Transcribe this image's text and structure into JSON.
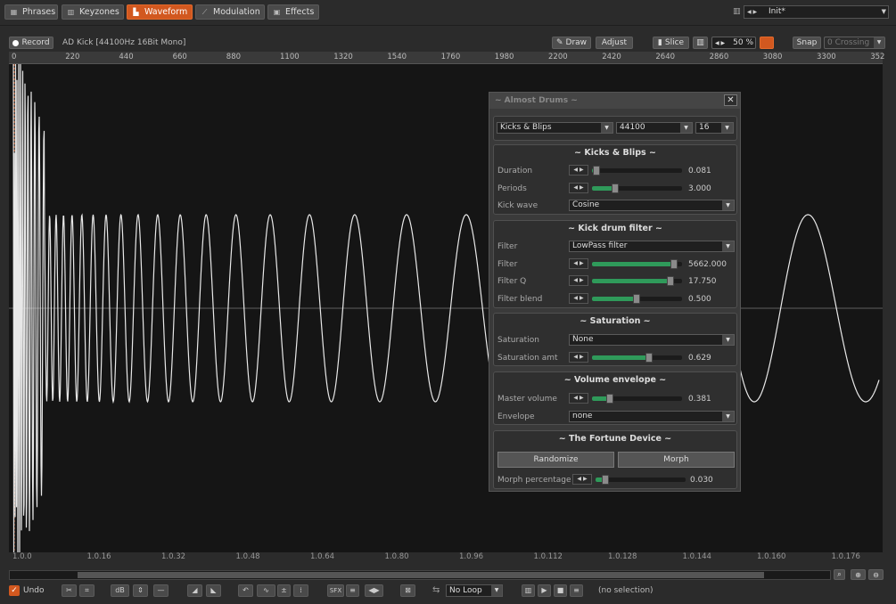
{
  "tabs": [
    {
      "label": "Phrases",
      "icon": "grid-icon"
    },
    {
      "label": "Keyzones",
      "icon": "piano-icon"
    },
    {
      "label": "Waveform",
      "icon": "waveform-icon"
    },
    {
      "label": "Modulation",
      "icon": "modulation-icon"
    },
    {
      "label": "Effects",
      "icon": "effects-icon"
    }
  ],
  "preset": {
    "label": "Init*"
  },
  "toolbar": {
    "record": "Record",
    "sample_name": "AD Kick [44100Hz 16Bit Mono]",
    "draw": "Draw",
    "adjust": "Adjust",
    "slice": "Slice",
    "zoom": "50 %",
    "snap": "Snap",
    "crossing": "0 Crossing"
  },
  "ruler": [
    "0",
    "220",
    "440",
    "660",
    "880",
    "1100",
    "1320",
    "1540",
    "1760",
    "1980",
    "2200",
    "2420",
    "2640",
    "2860",
    "3080",
    "3300",
    "352"
  ],
  "bottom_ruler": [
    "1.0.0",
    "1.0.16",
    "1.0.32",
    "1.0.48",
    "1.0.64",
    "1.0.80",
    "1.0.96",
    "1.0.112",
    "1.0.128",
    "1.0.144",
    "1.0.160",
    "1.0.176"
  ],
  "panel": {
    "title": "~ Almost Drums ~",
    "top": {
      "type": "Kicks & Blips",
      "rate": "44100",
      "bits": "16"
    },
    "kicks": {
      "title": "~ Kicks & Blips ~",
      "duration_label": "Duration",
      "duration": "0.081",
      "duration_level": 0.04,
      "periods_label": "Periods",
      "periods": "3.000",
      "periods_level": 0.27,
      "wave_label": "Kick wave",
      "wave": "Cosine"
    },
    "filter": {
      "title": "~ Kick drum filter ~",
      "type_label": "Filter",
      "type": "LowPass filter",
      "freq_label": "Filter",
      "freq": "5662.000",
      "freq_level": 0.92,
      "q_label": "Filter Q",
      "q": "17.750",
      "q_level": 0.88,
      "blend_label": "Filter blend",
      "blend": "0.500",
      "blend_level": 0.5
    },
    "saturation": {
      "title": "~ Saturation ~",
      "type_label": "Saturation",
      "type": "None",
      "amt_label": "Saturation amt",
      "amt": "0.629",
      "amt_level": 0.63
    },
    "volume": {
      "title": "~ Volume envelope ~",
      "master_label": "Master volume",
      "master": "0.381",
      "master_level": 0.2,
      "env_label": "Envelope",
      "env": "none"
    },
    "fortune": {
      "title": "~ The Fortune Device ~",
      "randomize": "Randomize",
      "morph": "Morph",
      "morph_pct_label": "Morph percentage",
      "morph_pct": "0.030",
      "morph_pct_level": 0.1
    }
  },
  "bottom": {
    "undo": "Undo",
    "sfx": "SFX",
    "loop": "No Loop",
    "selection": "(no selection)"
  },
  "colors": {
    "accent": "#d2581f",
    "slider": "#2f9a5a",
    "wave": "#e8e8e8"
  }
}
